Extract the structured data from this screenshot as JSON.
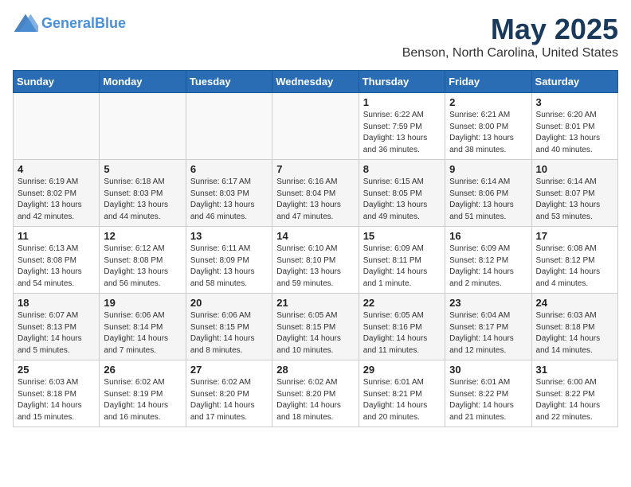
{
  "header": {
    "logo_line1": "General",
    "logo_line2": "Blue",
    "month": "May 2025",
    "location": "Benson, North Carolina, United States"
  },
  "weekdays": [
    "Sunday",
    "Monday",
    "Tuesday",
    "Wednesday",
    "Thursday",
    "Friday",
    "Saturday"
  ],
  "weeks": [
    [
      {
        "day": "",
        "info": ""
      },
      {
        "day": "",
        "info": ""
      },
      {
        "day": "",
        "info": ""
      },
      {
        "day": "",
        "info": ""
      },
      {
        "day": "1",
        "info": "Sunrise: 6:22 AM\nSunset: 7:59 PM\nDaylight: 13 hours\nand 36 minutes."
      },
      {
        "day": "2",
        "info": "Sunrise: 6:21 AM\nSunset: 8:00 PM\nDaylight: 13 hours\nand 38 minutes."
      },
      {
        "day": "3",
        "info": "Sunrise: 6:20 AM\nSunset: 8:01 PM\nDaylight: 13 hours\nand 40 minutes."
      }
    ],
    [
      {
        "day": "4",
        "info": "Sunrise: 6:19 AM\nSunset: 8:02 PM\nDaylight: 13 hours\nand 42 minutes."
      },
      {
        "day": "5",
        "info": "Sunrise: 6:18 AM\nSunset: 8:03 PM\nDaylight: 13 hours\nand 44 minutes."
      },
      {
        "day": "6",
        "info": "Sunrise: 6:17 AM\nSunset: 8:03 PM\nDaylight: 13 hours\nand 46 minutes."
      },
      {
        "day": "7",
        "info": "Sunrise: 6:16 AM\nSunset: 8:04 PM\nDaylight: 13 hours\nand 47 minutes."
      },
      {
        "day": "8",
        "info": "Sunrise: 6:15 AM\nSunset: 8:05 PM\nDaylight: 13 hours\nand 49 minutes."
      },
      {
        "day": "9",
        "info": "Sunrise: 6:14 AM\nSunset: 8:06 PM\nDaylight: 13 hours\nand 51 minutes."
      },
      {
        "day": "10",
        "info": "Sunrise: 6:14 AM\nSunset: 8:07 PM\nDaylight: 13 hours\nand 53 minutes."
      }
    ],
    [
      {
        "day": "11",
        "info": "Sunrise: 6:13 AM\nSunset: 8:08 PM\nDaylight: 13 hours\nand 54 minutes."
      },
      {
        "day": "12",
        "info": "Sunrise: 6:12 AM\nSunset: 8:08 PM\nDaylight: 13 hours\nand 56 minutes."
      },
      {
        "day": "13",
        "info": "Sunrise: 6:11 AM\nSunset: 8:09 PM\nDaylight: 13 hours\nand 58 minutes."
      },
      {
        "day": "14",
        "info": "Sunrise: 6:10 AM\nSunset: 8:10 PM\nDaylight: 13 hours\nand 59 minutes."
      },
      {
        "day": "15",
        "info": "Sunrise: 6:09 AM\nSunset: 8:11 PM\nDaylight: 14 hours\nand 1 minute."
      },
      {
        "day": "16",
        "info": "Sunrise: 6:09 AM\nSunset: 8:12 PM\nDaylight: 14 hours\nand 2 minutes."
      },
      {
        "day": "17",
        "info": "Sunrise: 6:08 AM\nSunset: 8:12 PM\nDaylight: 14 hours\nand 4 minutes."
      }
    ],
    [
      {
        "day": "18",
        "info": "Sunrise: 6:07 AM\nSunset: 8:13 PM\nDaylight: 14 hours\nand 5 minutes."
      },
      {
        "day": "19",
        "info": "Sunrise: 6:06 AM\nSunset: 8:14 PM\nDaylight: 14 hours\nand 7 minutes."
      },
      {
        "day": "20",
        "info": "Sunrise: 6:06 AM\nSunset: 8:15 PM\nDaylight: 14 hours\nand 8 minutes."
      },
      {
        "day": "21",
        "info": "Sunrise: 6:05 AM\nSunset: 8:15 PM\nDaylight: 14 hours\nand 10 minutes."
      },
      {
        "day": "22",
        "info": "Sunrise: 6:05 AM\nSunset: 8:16 PM\nDaylight: 14 hours\nand 11 minutes."
      },
      {
        "day": "23",
        "info": "Sunrise: 6:04 AM\nSunset: 8:17 PM\nDaylight: 14 hours\nand 12 minutes."
      },
      {
        "day": "24",
        "info": "Sunrise: 6:03 AM\nSunset: 8:18 PM\nDaylight: 14 hours\nand 14 minutes."
      }
    ],
    [
      {
        "day": "25",
        "info": "Sunrise: 6:03 AM\nSunset: 8:18 PM\nDaylight: 14 hours\nand 15 minutes."
      },
      {
        "day": "26",
        "info": "Sunrise: 6:02 AM\nSunset: 8:19 PM\nDaylight: 14 hours\nand 16 minutes."
      },
      {
        "day": "27",
        "info": "Sunrise: 6:02 AM\nSunset: 8:20 PM\nDaylight: 14 hours\nand 17 minutes."
      },
      {
        "day": "28",
        "info": "Sunrise: 6:02 AM\nSunset: 8:20 PM\nDaylight: 14 hours\nand 18 minutes."
      },
      {
        "day": "29",
        "info": "Sunrise: 6:01 AM\nSunset: 8:21 PM\nDaylight: 14 hours\nand 20 minutes."
      },
      {
        "day": "30",
        "info": "Sunrise: 6:01 AM\nSunset: 8:22 PM\nDaylight: 14 hours\nand 21 minutes."
      },
      {
        "day": "31",
        "info": "Sunrise: 6:00 AM\nSunset: 8:22 PM\nDaylight: 14 hours\nand 22 minutes."
      }
    ]
  ]
}
